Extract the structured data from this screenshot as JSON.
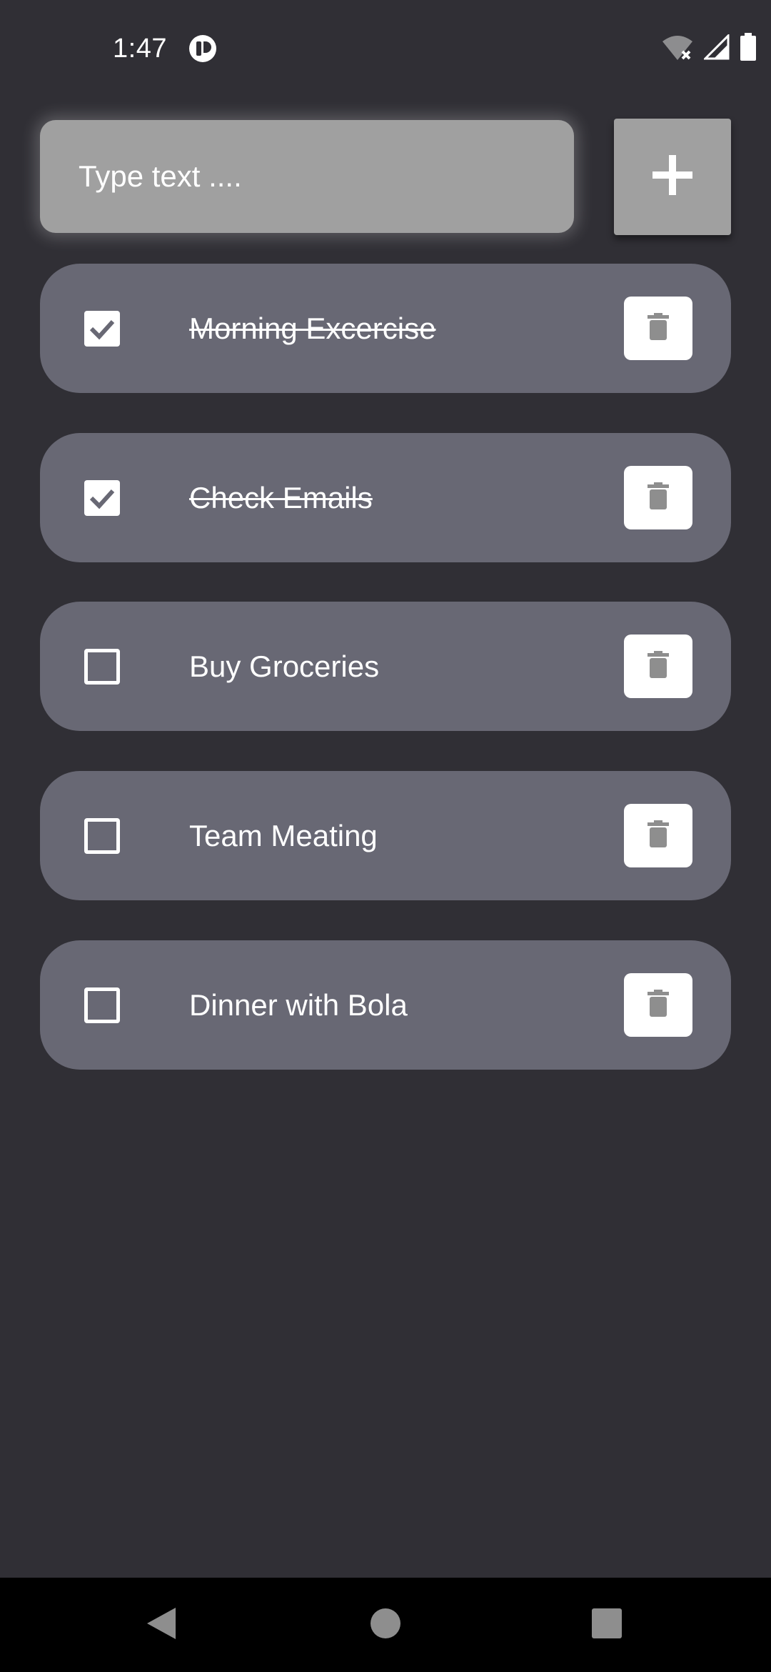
{
  "status_bar": {
    "time": "1:47",
    "app_icon": "tethering-app-icon",
    "icons": [
      "wifi-off-icon",
      "cellular-signal-icon",
      "battery-icon"
    ]
  },
  "input": {
    "placeholder": "Type text ....",
    "value": ""
  },
  "add_button": {
    "icon": "plus-icon"
  },
  "tasks": [
    {
      "label": "Morning Excercise",
      "checked": true
    },
    {
      "label": "Check Emails",
      "checked": true
    },
    {
      "label": "Buy Groceries",
      "checked": false
    },
    {
      "label": "Team Meating",
      "checked": false
    },
    {
      "label": "Dinner with Bola",
      "checked": false
    }
  ],
  "nav": {
    "icons": [
      "back-icon",
      "home-icon",
      "recents-icon"
    ]
  },
  "colors": {
    "background": "#302f35",
    "card": "#686874",
    "input": "#a0a0a0",
    "icon_gray": "#8e8e8e"
  }
}
